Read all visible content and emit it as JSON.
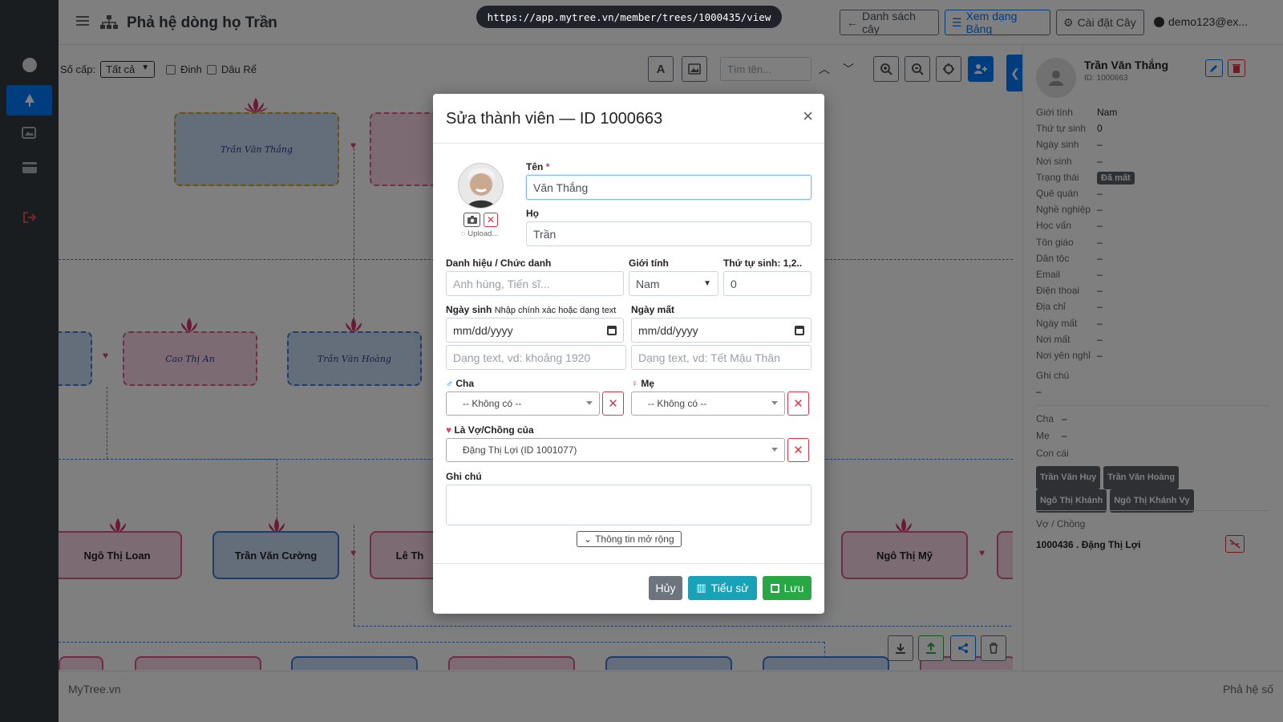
{
  "url": "https://app.mytree.vn/member/trees/1000435/view",
  "header": {
    "title": "Phả hệ dòng họ Trần",
    "btn_list": "Danh sách cây",
    "btn_table": "Xem dạng Bảng",
    "btn_settings": "Cài đặt Cây",
    "user": "demo123@ex..."
  },
  "toolbar": {
    "level_label": "Số cấp:",
    "level_value": "Tất cả",
    "chk_dinh": "Đinh",
    "chk_daure": "Dâu Rể",
    "search_placeholder": "Tìm tên..."
  },
  "tree": {
    "n1": "Trần Văn Thắng",
    "n2": "Cao Thị An",
    "n3": "Trần Văn Hoàng",
    "n4": "Ngô Thị Loan",
    "n5": "Trần Văn Cường",
    "n6": "Lê Th",
    "n7": "Ngô Thị Mỹ"
  },
  "modal": {
    "title": "Sửa thành viên — ID 1000663",
    "upload_text": "Upload...",
    "ten_label": "Tên",
    "ten_value": "Văn Thắng",
    "ho_label": "Họ",
    "ho_value": "Trần",
    "danhhieu_label": "Danh hiệu / Chức danh",
    "danhhieu_placeholder": "Anh hùng, Tiến sĩ...",
    "gioitinh_label": "Giới tính",
    "gioitinh_value": "Nam",
    "thutu_label": "Thứ tự sinh: 1,2..",
    "thutu_value": "0",
    "ngaysinh_label": "Ngày sinh",
    "ngaysinh_hint": "Nhập chính xác hoặc dạng text",
    "ngaysinh_date": "mm/dd/yyyy",
    "ngaysinh_text_placeholder": "Dạng text, vd: khoảng 1920",
    "ngaymat_label": "Ngày mất",
    "ngaymat_date": "mm/dd/yyyy",
    "ngaymat_text_placeholder": "Dạng text, vd: Tết Mậu Thân",
    "cha_label": "Cha",
    "cha_value": "-- Không có --",
    "me_label": "Mẹ",
    "me_value": "-- Không có --",
    "vochong_label": "Là Vợ/Chồng của",
    "vochong_value": "Đặng Thị Lợi (ID 1001077)",
    "ghichu_label": "Ghi chú",
    "more_btn": "Thông tin mở rộng",
    "btn_cancel": "Hủy",
    "btn_bio": "Tiểu sử",
    "btn_save": "Lưu"
  },
  "panel": {
    "name": "Trần Văn Thắng",
    "id": "ID: 1000663",
    "fields": [
      {
        "label": "Giới tính",
        "value": "Nam"
      },
      {
        "label": "Thứ tự sinh",
        "value": "0"
      },
      {
        "label": "Ngày sinh",
        "value": "–"
      },
      {
        "label": "Nơi sinh",
        "value": "–"
      },
      {
        "label": "Trạng thái",
        "value": "Đã mất"
      },
      {
        "label": "Quê quán",
        "value": "–"
      },
      {
        "label": "Nghề nghiệp",
        "value": "–"
      },
      {
        "label": "Học vấn",
        "value": "–"
      },
      {
        "label": "Tôn giáo",
        "value": "–"
      },
      {
        "label": "Dân tộc",
        "value": "–"
      },
      {
        "label": "Email",
        "value": "–"
      },
      {
        "label": "Điện thoại",
        "value": "–"
      },
      {
        "label": "Địa chỉ",
        "value": "–"
      },
      {
        "label": "Ngày mất",
        "value": "–"
      },
      {
        "label": "Nơi mất",
        "value": "–"
      },
      {
        "label": "Nơi yên nghỉ",
        "value": "–"
      }
    ],
    "ghichu_label": "Ghi chú",
    "ghichu_value": "–",
    "cha_label": "Cha",
    "cha_value": "–",
    "me_label": "Mẹ",
    "me_value": "–",
    "concai_label": "Con cái",
    "children": [
      "Trần Văn Huy",
      "Trần Văn Hoàng",
      "Ngô Thị Khánh",
      "Ngô Thị Khánh Vy"
    ],
    "spouse_label": "Vợ / Chồng",
    "spouse_value": "1000436 . Đặng Thị Lợi"
  },
  "footer": {
    "left": "MyTree.vn",
    "right": "Phả hệ số"
  },
  "colors": {
    "primary": "#007bff",
    "info": "#17a2b8",
    "success": "#28a745",
    "danger": "#dc3545",
    "secondary": "#6c757d",
    "sidebar": "#343a40"
  }
}
